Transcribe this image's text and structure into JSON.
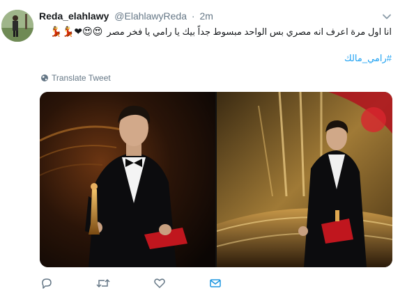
{
  "tweet": {
    "author_name": "Reda_elahlawy",
    "handle": "@ElahlawyReda",
    "separator": "·",
    "time": "2m",
    "text": "انا اول مرة اعرف انه مصري بس الواحد مبسوط جداً بيك يا رامي يا فخر مصر",
    "emojis": "😍😍❤💃💃",
    "hashtag": "#رامي_مالك",
    "translate_label": "Translate Tweet"
  },
  "icons": {
    "caret": "chevron-down-icon",
    "translate": "globe-icon",
    "reply": "reply-icon",
    "retweet": "retweet-icon",
    "like": "heart-icon",
    "dm": "envelope-icon"
  },
  "colors": {
    "link": "#1da1f2",
    "secondary_text": "#657786",
    "primary_text": "#14171a",
    "envelope": "#1b95e0"
  }
}
